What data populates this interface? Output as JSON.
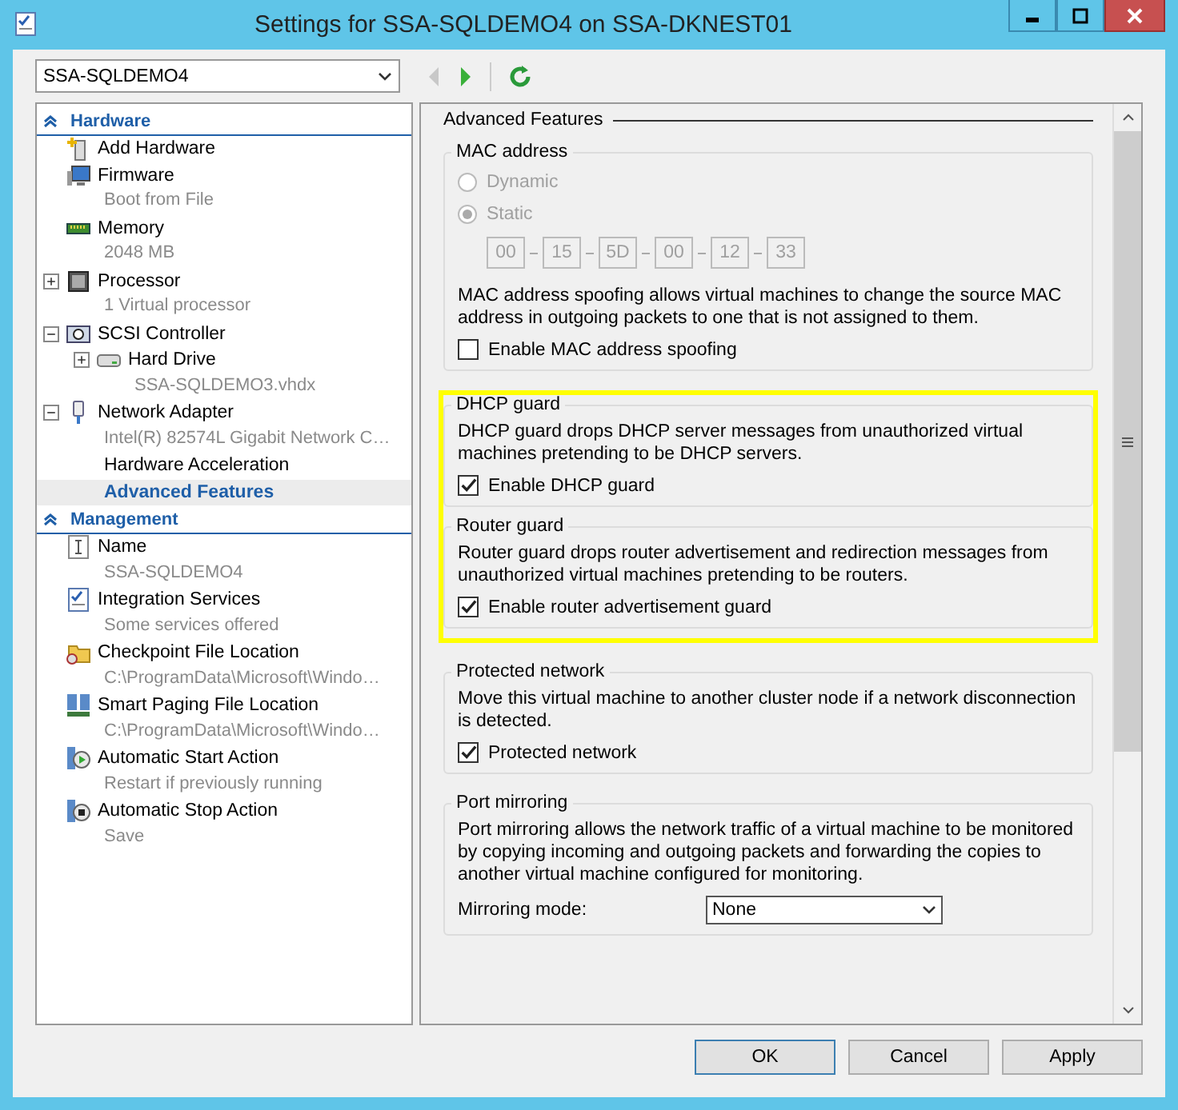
{
  "window": {
    "title": "Settings for SSA-SQLDEMO4 on SSA-DKNEST01"
  },
  "toolbar": {
    "vm_select": "SSA-SQLDEMO4",
    "back_disabled": true,
    "forward_disabled": false
  },
  "tree": [
    {
      "title": "Hardware",
      "items": [
        {
          "kind": "add",
          "label": "Add Hardware",
          "selected": false
        },
        {
          "kind": "firmware",
          "label": "Firmware",
          "detail": "Boot from File",
          "selected": false
        },
        {
          "kind": "memory",
          "label": "Memory",
          "detail": "2048 MB",
          "selected": false
        },
        {
          "kind": "cpu",
          "label": "Processor",
          "detail": "1 Virtual processor",
          "expanded": false,
          "selected": false
        },
        {
          "kind": "scsi",
          "label": "SCSI Controller",
          "expanded": true,
          "selected": false,
          "children": [
            {
              "kind": "disk",
              "label": "Hard Drive",
              "detail": "SSA-SQLDEMO3.vhdx",
              "expanded": false,
              "selected": false
            }
          ]
        },
        {
          "kind": "nic",
          "label": "Network Adapter",
          "detail": "Intel(R) 82574L Gigabit Network C…",
          "expanded": true,
          "selected": false,
          "children": [
            {
              "kind": "plain",
              "label": "Hardware Acceleration",
              "selected": false
            },
            {
              "kind": "plain",
              "label": "Advanced Features",
              "selected": true
            }
          ]
        }
      ]
    },
    {
      "title": "Management",
      "items": [
        {
          "kind": "name",
          "label": "Name",
          "detail": "SSA-SQLDEMO4",
          "selected": false
        },
        {
          "kind": "services",
          "label": "Integration Services",
          "detail": "Some services offered",
          "selected": false
        },
        {
          "kind": "folder",
          "label": "Checkpoint File Location",
          "detail": "C:\\ProgramData\\Microsoft\\Windo…",
          "selected": false
        },
        {
          "kind": "paging",
          "label": "Smart Paging File Location",
          "detail": "C:\\ProgramData\\Microsoft\\Windo…",
          "selected": false
        },
        {
          "kind": "start",
          "label": "Automatic Start Action",
          "detail": "Restart if previously running",
          "selected": false
        },
        {
          "kind": "stop",
          "label": "Automatic Stop Action",
          "detail": "Save",
          "selected": false
        }
      ]
    }
  ],
  "page": {
    "title": "Advanced Features",
    "groups": [
      {
        "title": "MAC address",
        "highlighted": false,
        "disabled": true,
        "radios": [
          {
            "label": "Dynamic",
            "selected": false
          },
          {
            "label": "Static",
            "selected": true
          }
        ],
        "mac": [
          "00",
          "15",
          "5D",
          "00",
          "12",
          "33"
        ],
        "description": "MAC address spoofing allows virtual machines to change the source MAC address in outgoing packets to one that is not assigned to them.",
        "checkbox": {
          "label": "Enable MAC address spoofing",
          "checked": false
        }
      },
      {
        "title": "DHCP guard",
        "highlighted": true,
        "description": "DHCP guard drops DHCP server messages from unauthorized virtual machines pretending to be DHCP servers.",
        "checkbox": {
          "label": "Enable DHCP guard",
          "checked": true
        }
      },
      {
        "title": "Router guard",
        "highlighted": true,
        "description": "Router guard drops router advertisement and redirection messages from unauthorized virtual machines pretending to be routers.",
        "checkbox": {
          "label": "Enable router advertisement guard",
          "checked": true
        }
      },
      {
        "title": "Protected network",
        "highlighted": false,
        "description": "Move this virtual machine to another cluster node if a network disconnection is detected.",
        "checkbox": {
          "label": "Protected network",
          "checked": true
        }
      },
      {
        "title": "Port mirroring",
        "highlighted": false,
        "description": "Port mirroring allows the network traffic of a virtual machine to be monitored by copying incoming and outgoing packets and forwarding the copies to another virtual machine configured for monitoring.",
        "select": {
          "label": "Mirroring mode:",
          "value": "None"
        }
      }
    ]
  },
  "buttons": [
    {
      "label": "OK",
      "default": true
    },
    {
      "label": "Cancel",
      "default": false
    },
    {
      "label": "Apply",
      "default": false
    }
  ]
}
